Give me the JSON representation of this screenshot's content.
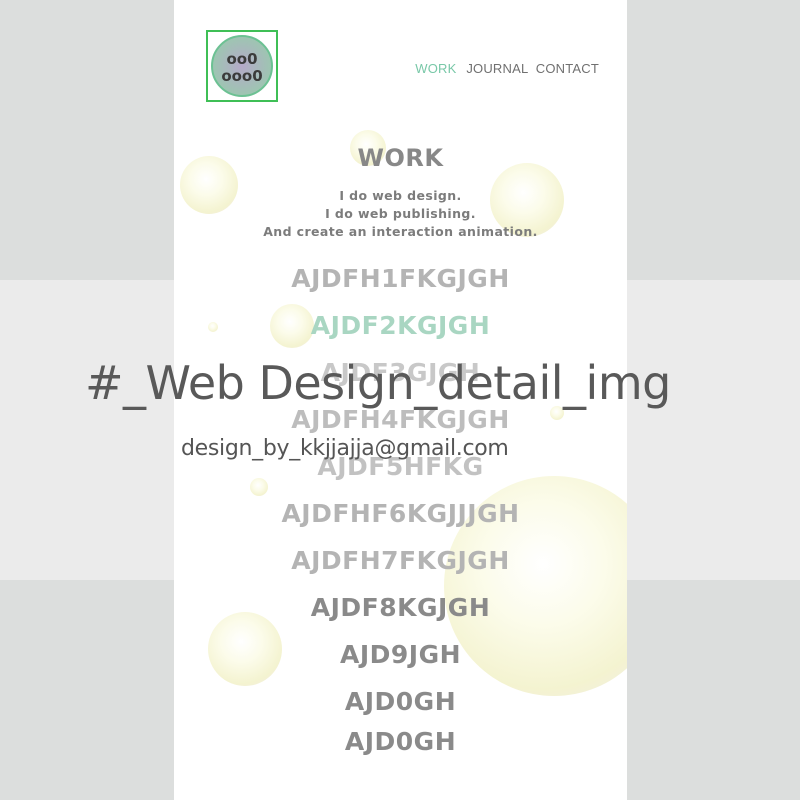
{
  "logo": {
    "line1": "oo0",
    "line2": "ooo0"
  },
  "nav": {
    "items": [
      "WORK",
      "JOURNAL",
      "CONTACT"
    ],
    "active": "WORK"
  },
  "work": {
    "title": "WORK",
    "lines": [
      "I do web design.",
      "I do web publishing.",
      "And create an interaction animation."
    ]
  },
  "list": [
    "AJDFH1FKGJGH",
    "AJDF2KGJGH",
    "AJDF3GJGH",
    "AJDFH4FKGJGH",
    "AJDF5HFKG",
    "AJDFHF6KGJJJGH",
    "AJDFH7FKGJGH",
    "AJDF8KGJGH",
    "AJD9JGH",
    "AJD0GH",
    "AJD0GH"
  ],
  "overlay": {
    "title": "#_Web Design_detail_img",
    "subtitle": "design_by_kkjjajja@gmail.com"
  },
  "colors": {
    "accent": "#79c8a8",
    "logo_border": "#3fbf56",
    "list_light": "#b4b4b4",
    "list_dark": "#8a8a8a"
  }
}
